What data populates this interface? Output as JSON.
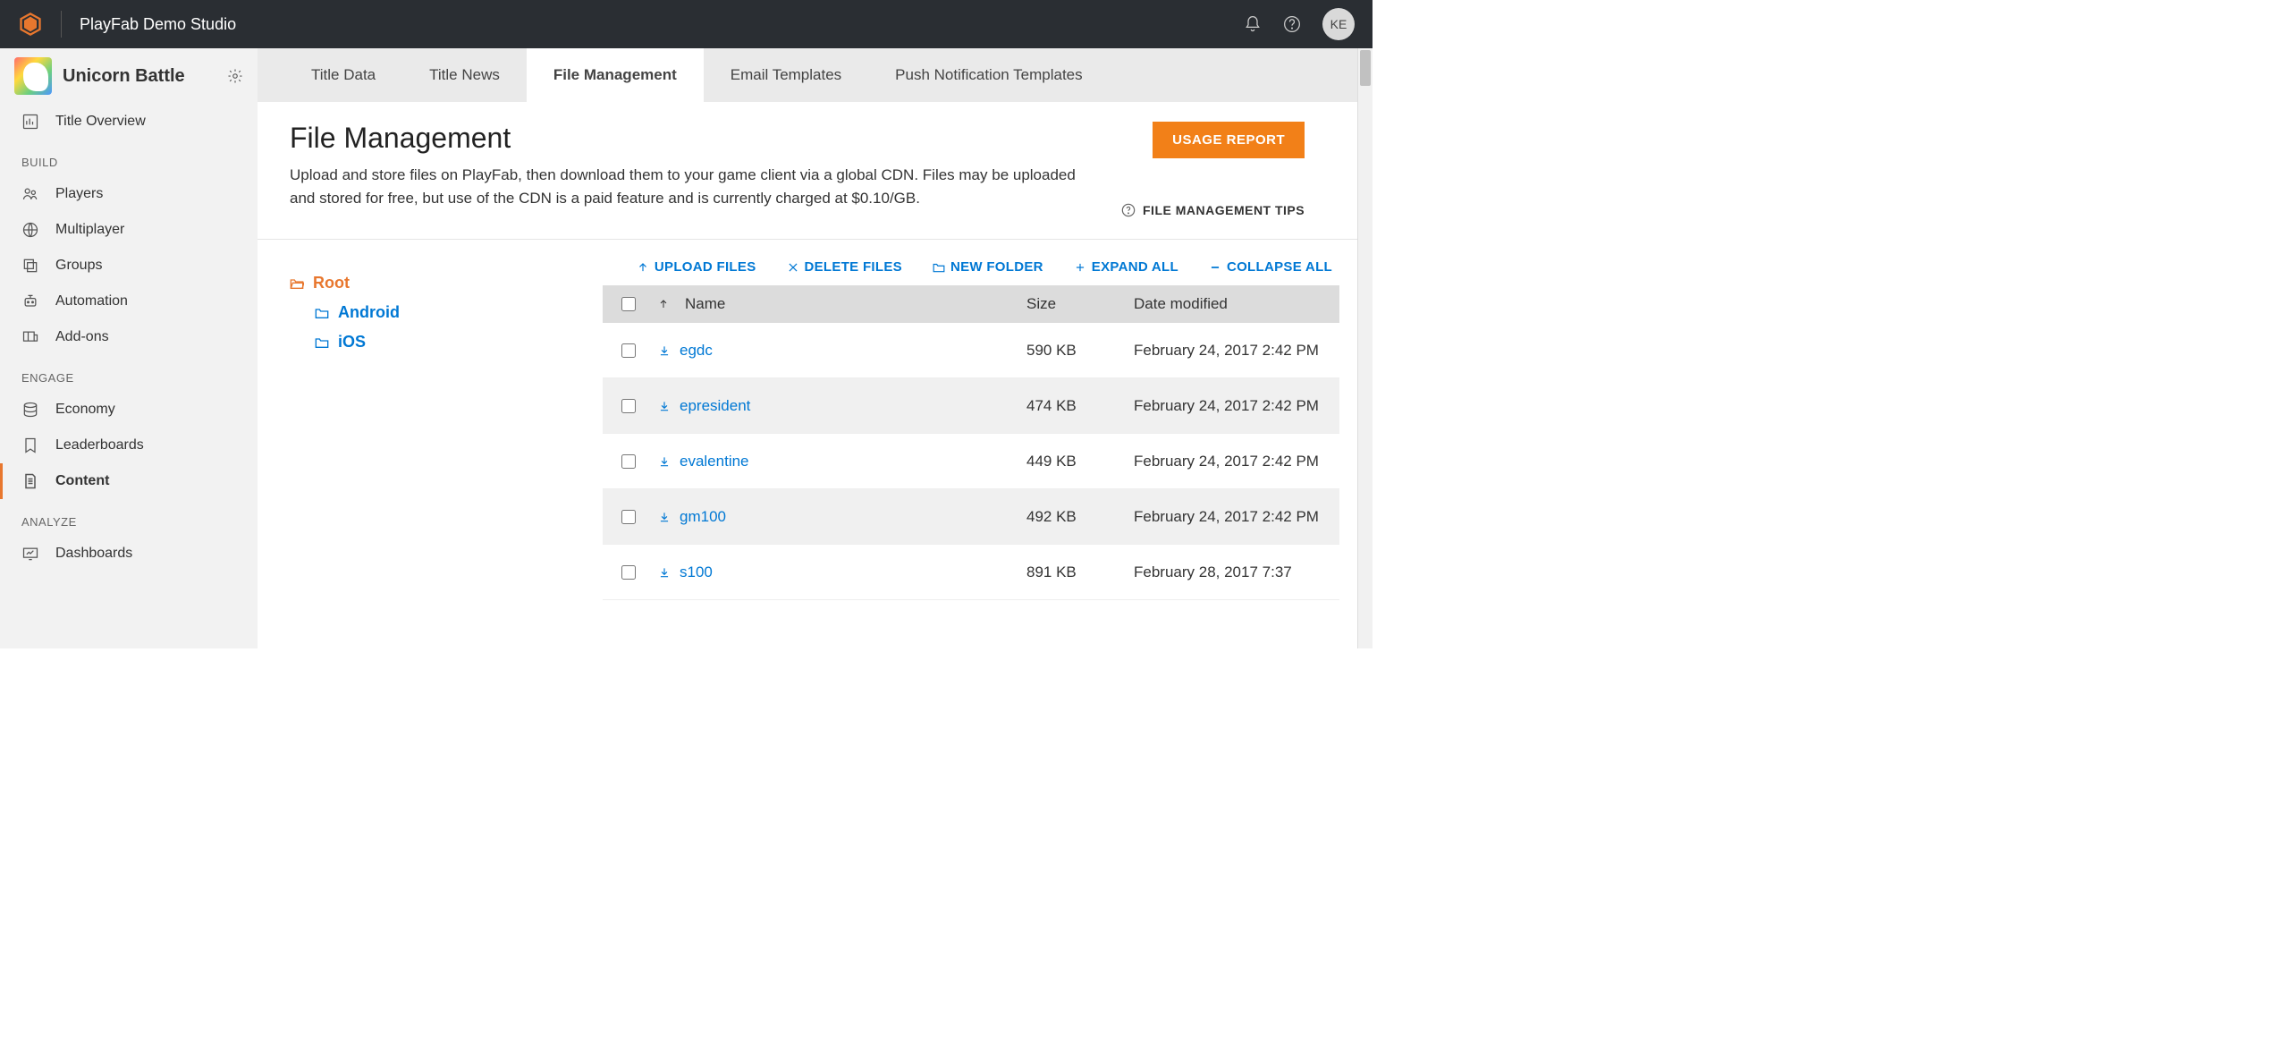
{
  "header": {
    "studio_name": "PlayFab Demo Studio",
    "avatar_initials": "KE"
  },
  "sidebar": {
    "title_name": "Unicorn Battle",
    "overview_label": "Title Overview",
    "sections": {
      "build": {
        "label": "BUILD",
        "items": [
          "Players",
          "Multiplayer",
          "Groups",
          "Automation",
          "Add-ons"
        ]
      },
      "engage": {
        "label": "ENGAGE",
        "items": [
          "Economy",
          "Leaderboards",
          "Content"
        ]
      },
      "analyze": {
        "label": "ANALYZE",
        "items": [
          "Dashboards"
        ]
      }
    }
  },
  "tabs": [
    "Title Data",
    "Title News",
    "File Management",
    "Email Templates",
    "Push Notification Templates"
  ],
  "active_tab": "File Management",
  "page": {
    "title": "File Management",
    "desc": "Upload and store files on PlayFab, then download them to your game client via a global CDN. Files may be uploaded and stored for free, but use of the CDN is a paid feature and is currently charged at $0.10/GB.",
    "usage_report": "USAGE REPORT",
    "tips": "FILE MANAGEMENT TIPS"
  },
  "tree": {
    "root": "Root",
    "children": [
      "Android",
      "iOS"
    ]
  },
  "file_actions": {
    "upload": "UPLOAD FILES",
    "delete": "DELETE FILES",
    "new_folder": "NEW FOLDER",
    "expand": "EXPAND ALL",
    "collapse": "COLLAPSE ALL"
  },
  "table": {
    "cols": {
      "name": "Name",
      "size": "Size",
      "date": "Date modified"
    },
    "rows": [
      {
        "name": "egdc",
        "size": "590 KB",
        "date": "February 24, 2017 2:42 PM"
      },
      {
        "name": "epresident",
        "size": "474 KB",
        "date": "February 24, 2017 2:42 PM"
      },
      {
        "name": "evalentine",
        "size": "449 KB",
        "date": "February 24, 2017 2:42 PM"
      },
      {
        "name": "gm100",
        "size": "492 KB",
        "date": "February 24, 2017 2:42 PM"
      },
      {
        "name": "s100",
        "size": "891 KB",
        "date": "February 28, 2017 7:37"
      }
    ]
  }
}
